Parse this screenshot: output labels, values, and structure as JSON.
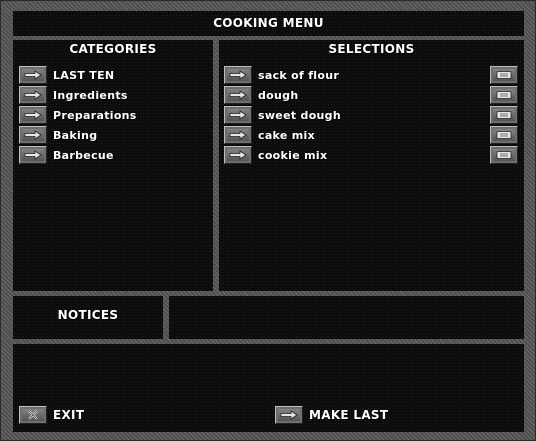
{
  "title": "COOKING MENU",
  "categories": {
    "header": "CATEGORIES",
    "items": [
      {
        "label": "LAST TEN"
      },
      {
        "label": "Ingredients"
      },
      {
        "label": "Preparations"
      },
      {
        "label": "Baking"
      },
      {
        "label": "Barbecue"
      }
    ]
  },
  "selections": {
    "header": "SELECTIONS",
    "items": [
      {
        "label": "sack of flour"
      },
      {
        "label": "dough"
      },
      {
        "label": "sweet dough"
      },
      {
        "label": "cake mix"
      },
      {
        "label": "cookie mix"
      }
    ]
  },
  "notices": {
    "label": "NOTICES",
    "text": ""
  },
  "footer": {
    "exit_label": "EXIT",
    "make_last_label": "MAKE LAST"
  },
  "icons": {
    "select": "arrow-right-icon",
    "details": "scroll-icon",
    "exit": "x-icon"
  }
}
